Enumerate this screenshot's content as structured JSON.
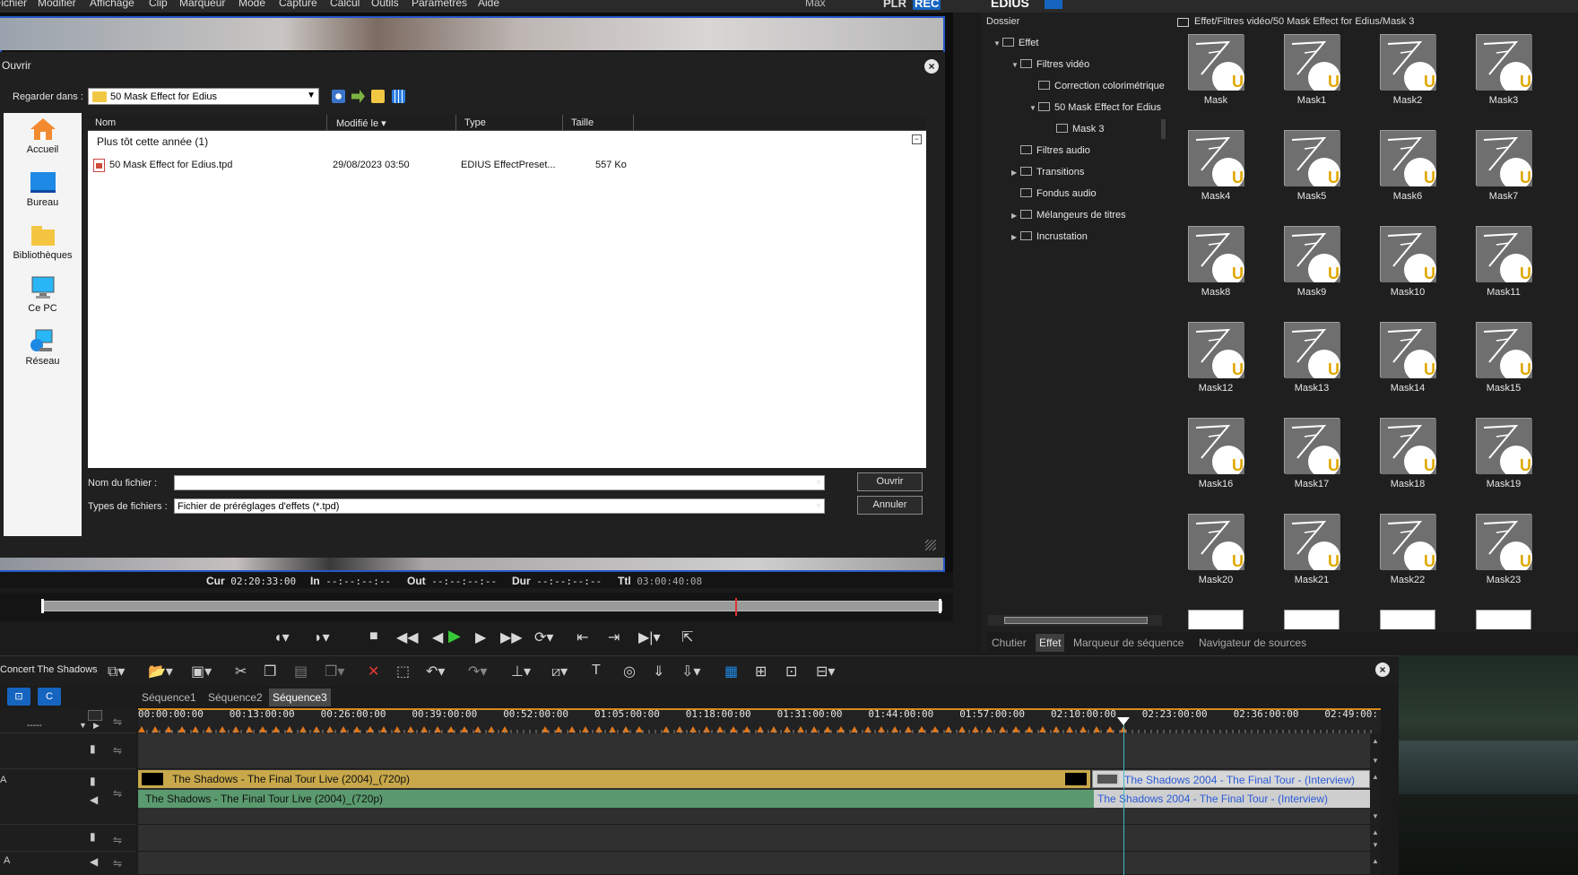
{
  "menubar": {
    "items": [
      "Fichier",
      "Modifier",
      "Affichage",
      "Clip",
      "Marqueur",
      "Mode",
      "Capture",
      "Calcul",
      "Outils",
      "Paramètres",
      "Aide"
    ],
    "max_label": "Max",
    "plr_label": "PLR",
    "rec_label": "REC",
    "edius_label": "EDIUS"
  },
  "dialog": {
    "title": "Ouvrir",
    "lookin_label": "Regarder dans :",
    "lookin_value": "50 Mask Effect for Edius",
    "places": [
      "Accueil",
      "Bureau",
      "Bibliothèques",
      "Ce PC",
      "Réseau"
    ],
    "columns": [
      "Nom",
      "Modifié le",
      "Type",
      "Taille"
    ],
    "sort_indicator": "▾",
    "group_label": "Plus tôt cette année (1)",
    "file": {
      "name": "50 Mask Effect for Edius.tpd",
      "modified": "29/08/2023 03:50",
      "type": "EDIUS EffectPreset...",
      "size": "557 Ko"
    },
    "filename_label": "Nom du fichier :",
    "filename_value": "",
    "filetype_label": "Types de fichiers :",
    "filetype_value": "Fichier de préréglages d'effets (*.tpd)",
    "open_button": "Ouvrir",
    "cancel_button": "Annuler"
  },
  "timecodes": {
    "cur_label": "Cur",
    "cur": "02:20:33:00",
    "in_label": "In",
    "in": "--:--:--:--",
    "out_label": "Out",
    "out": "--:--:--:--",
    "dur_label": "Dur",
    "dur": "--:--:--:--",
    "ttl_label": "Ttl",
    "ttl": "03:00:40:08"
  },
  "bin": {
    "dossier_label": "Dossier",
    "path": "Effet/Filtres vidéo/50 Mask Effect for Edius/Mask 3",
    "tree": [
      {
        "label": "Effet",
        "level": 0,
        "twisty": "▼"
      },
      {
        "label": "Filtres vidéo",
        "level": 1,
        "twisty": "▼"
      },
      {
        "label": "Correction colorimétrique",
        "level": 2,
        "twisty": ""
      },
      {
        "label": "50 Mask Effect for Edius",
        "level": 2,
        "twisty": "▼"
      },
      {
        "label": "Mask 3",
        "level": 3,
        "twisty": "",
        "selected": true
      },
      {
        "label": "Filtres audio",
        "level": 1,
        "twisty": ""
      },
      {
        "label": "Transitions",
        "level": 1,
        "twisty": "▶"
      },
      {
        "label": "Fondus audio",
        "level": 1,
        "twisty": ""
      },
      {
        "label": "Mélangeurs de titres",
        "level": 1,
        "twisty": "▶"
      },
      {
        "label": "Incrustation",
        "level": 1,
        "twisty": "▶"
      }
    ],
    "items": [
      "Mask",
      "Mask1",
      "Mask2",
      "Mask3",
      "Mask4",
      "Mask5",
      "Mask6",
      "Mask7",
      "Mask8",
      "Mask9",
      "Mask10",
      "Mask11",
      "Mask12",
      "Mask13",
      "Mask14",
      "Mask15",
      "Mask16",
      "Mask17",
      "Mask18",
      "Mask19",
      "Mask20",
      "Mask21",
      "Mask22",
      "Mask23"
    ],
    "tabs": [
      "Chutier",
      "Effet",
      "Marqueur de séquence",
      "Navigateur de sources"
    ],
    "active_tab": "Effet"
  },
  "timeline": {
    "project_name": "Concert The Shadows",
    "sequences": [
      "Séquence1",
      "Séquence2",
      "Séquence3"
    ],
    "active_sequence": "Séquence3",
    "ruler": [
      "00:00:00:00",
      "00:13:00:00",
      "00:26:00:00",
      "00:39:00:00",
      "00:52:00:00",
      "01:05:00:00",
      "01:18:00:00",
      "01:31:00:00",
      "01:44:00:00",
      "01:57:00:00",
      "02:10:00:00",
      "02:23:00:00",
      "02:36:00:00",
      "02:49:00:"
    ],
    "track_dropdown": "-----",
    "track_a_label": "A",
    "track_a2_label": "A",
    "clip_video_1": "The Shadows - The Final Tour Live (2004)_(720p)",
    "clip_audio_1": "The Shadows - The Final Tour Live (2004)_(720p)",
    "clip_video_2": "The Shadows 2004 - The Final Tour - (Interview)",
    "clip_audio_2": "The Shadows 2004 - The Final Tour - (Interview)"
  },
  "colors": {
    "accent": "#2657c9",
    "clip_video": "#c8a84a",
    "clip_audio": "#5a9a6e",
    "mode_button": "#1565c0",
    "playhead": "#3fb8c8"
  }
}
